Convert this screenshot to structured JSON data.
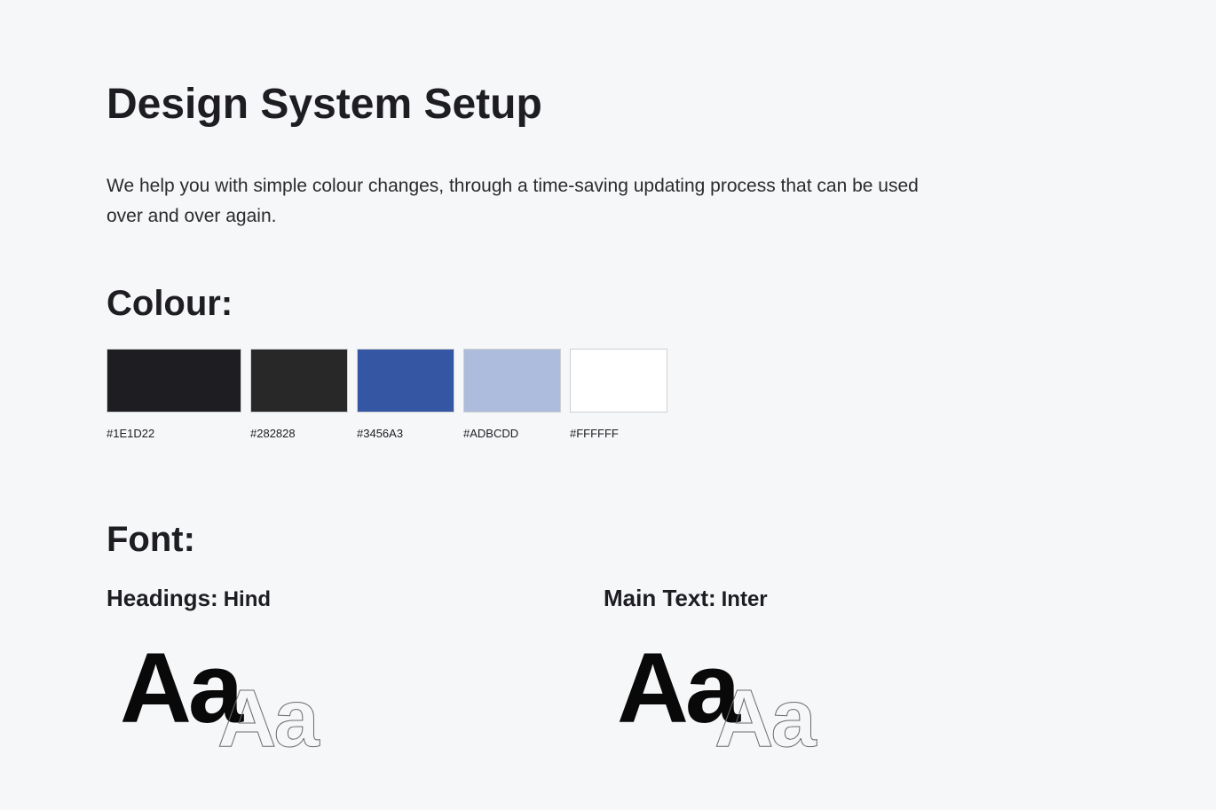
{
  "title": "Design System Setup",
  "intro": "We help you with simple colour changes, through a time-saving updating process that can be used over and over again.",
  "colour": {
    "heading": "Colour:",
    "swatches": [
      {
        "hex": "#1E1D22"
      },
      {
        "hex": "#282828"
      },
      {
        "hex": "#3456A3"
      },
      {
        "hex": "#ADBCDD"
      },
      {
        "hex": "#FFFFFF"
      }
    ]
  },
  "font": {
    "heading": "Font:",
    "headings_label": "Headings:",
    "headings_font": "Hind",
    "maintext_label": "Main Text:",
    "maintext_font": "Inter",
    "sample_solid": "Aa",
    "sample_outline": "Aa"
  }
}
